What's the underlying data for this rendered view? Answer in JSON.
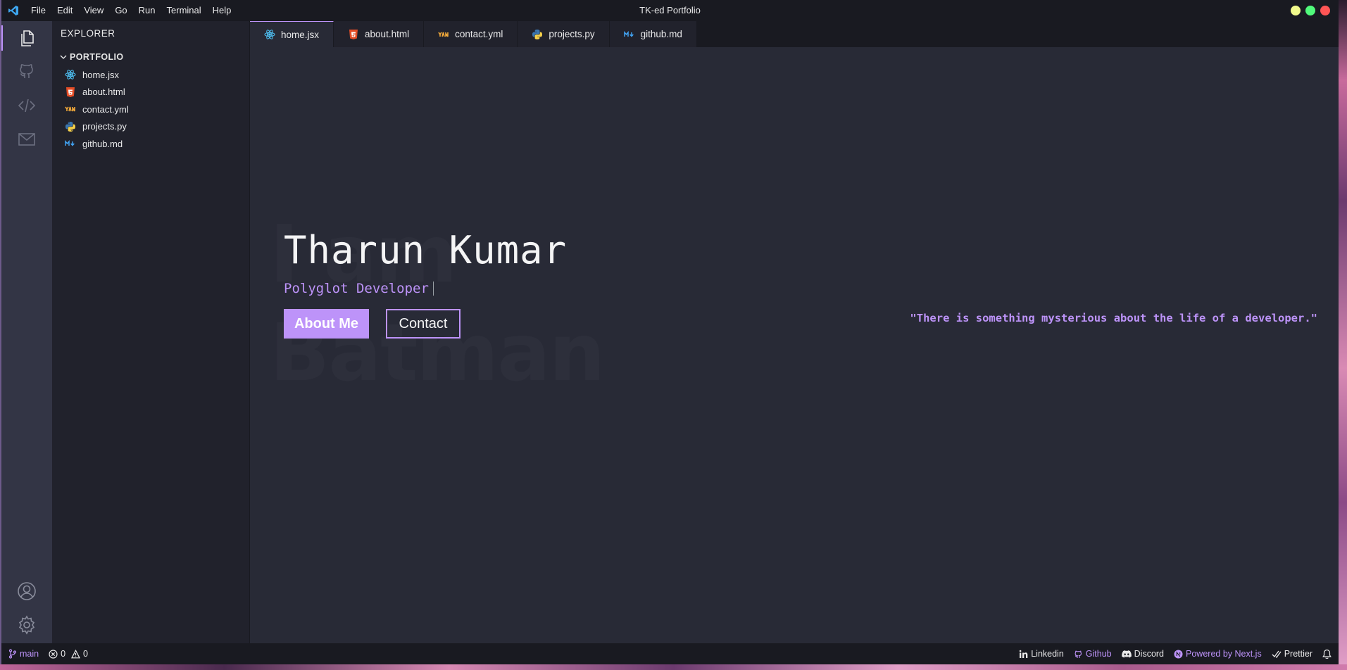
{
  "window": {
    "title": "TK-ed Portfolio"
  },
  "menu": [
    "File",
    "Edit",
    "View",
    "Go",
    "Run",
    "Terminal",
    "Help"
  ],
  "traffic_colors": {
    "minimize": "#f1fa8c",
    "maximize": "#50fa7b",
    "close": "#ff5555"
  },
  "sidebar": {
    "title": "EXPLORER",
    "folder": "PORTFOLIO",
    "files": [
      {
        "label": "home.jsx",
        "icon": "react-icon"
      },
      {
        "label": "about.html",
        "icon": "html-icon"
      },
      {
        "label": "contact.yml",
        "icon": "yaml-icon"
      },
      {
        "label": "projects.py",
        "icon": "python-icon"
      },
      {
        "label": "github.md",
        "icon": "markdown-icon"
      }
    ]
  },
  "tabs": [
    {
      "label": "home.jsx",
      "icon": "react-icon"
    },
    {
      "label": "about.html",
      "icon": "html-icon"
    },
    {
      "label": "contact.yml",
      "icon": "yaml-icon"
    },
    {
      "label": "projects.py",
      "icon": "python-icon"
    },
    {
      "label": "github.md",
      "icon": "markdown-icon"
    }
  ],
  "hero": {
    "background_line1": "I am",
    "background_line2": "Batman",
    "name": "Tharun Kumar",
    "role": "Polyglot Developer",
    "about_button": "About Me",
    "contact_button": "Contact",
    "quote": "\"There is something mysterious about the life of a developer.\""
  },
  "statusbar": {
    "branch": "main",
    "errors": "0",
    "warnings": "0",
    "linkedin": "Linkedin",
    "github": "Github",
    "discord": "Discord",
    "powered": "Powered by Next.js",
    "prettier": "Prettier"
  },
  "colors": {
    "accent": "#bd93f9",
    "editor_bg": "#282a36",
    "sidebar_bg": "#21222c",
    "activity_bg": "#333545"
  }
}
